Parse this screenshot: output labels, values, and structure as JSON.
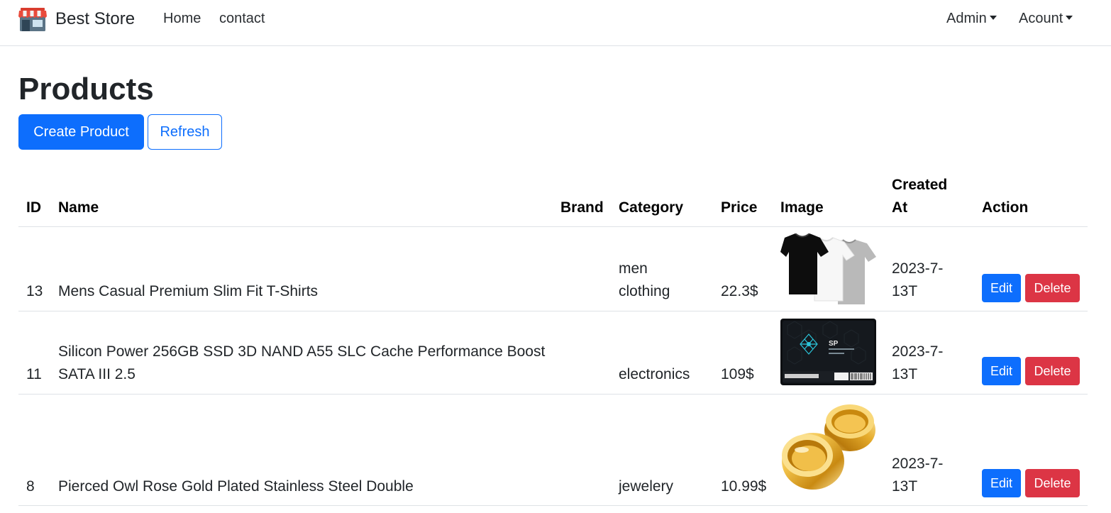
{
  "navbar": {
    "brand": "Best Store",
    "links": {
      "home": "Home",
      "contact": "contact"
    },
    "dropdowns": {
      "admin": "Admin",
      "account": "Acount"
    }
  },
  "page": {
    "title": "Products",
    "create_label": "Create Product",
    "refresh_label": "Refresh"
  },
  "table": {
    "headers": {
      "id": "ID",
      "name": "Name",
      "brand": "Brand",
      "category": "Category",
      "price": "Price",
      "image": "Image",
      "created_line1": "Created",
      "created_line2": "At",
      "action": "Action"
    },
    "rows": [
      {
        "id": "13",
        "name": "Mens Casual Premium Slim Fit T-Shirts",
        "brand": "",
        "category_line1": "men",
        "category_line2": "clothing",
        "price": "22.3$",
        "image": "t-shirts-image",
        "created_line1": "2023-7-",
        "created_line2": "13T",
        "edit": "Edit",
        "delete": "Delete"
      },
      {
        "id": "11",
        "name_line1": "Silicon Power 256GB SSD 3D NAND A55 SLC Cache Performance Boost",
        "name_line2": "SATA III 2.5",
        "brand": "",
        "category": "electronics",
        "price": "109$",
        "image": "ssd-image",
        "created_line1": "2023-7-",
        "created_line2": "13T",
        "edit": "Edit",
        "delete": "Delete"
      },
      {
        "id": "8",
        "name": "Pierced Owl Rose Gold Plated Stainless Steel Double",
        "brand": "",
        "category": "jewelery",
        "price": "10.99$",
        "image": "gold-plugs-image",
        "created_line1": "2023-7-",
        "created_line2": "13T",
        "edit": "Edit",
        "delete": "Delete"
      }
    ]
  },
  "colors": {
    "primary": "#0d6efd",
    "danger": "#dc3545",
    "border": "#dee2e6",
    "text": "#212529"
  }
}
